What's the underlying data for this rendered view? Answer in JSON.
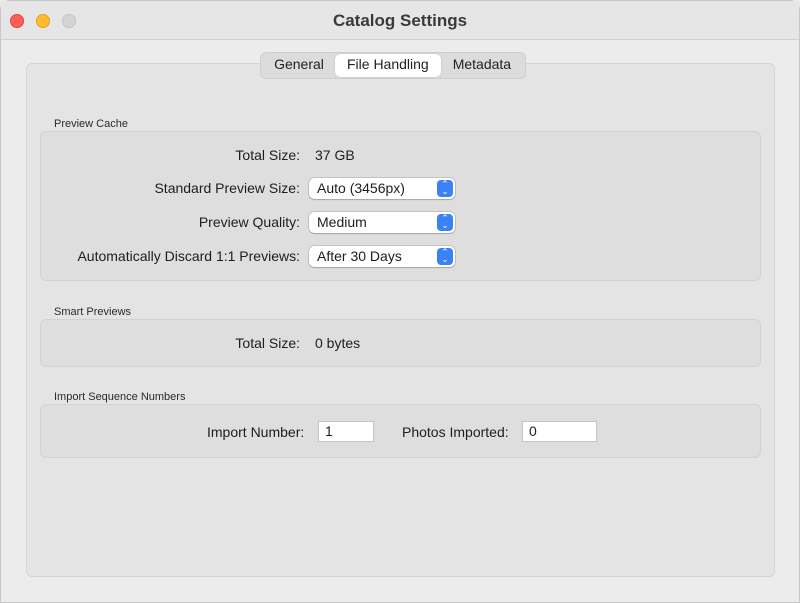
{
  "window": {
    "title": "Catalog Settings"
  },
  "tabs": [
    {
      "label": "General",
      "active": false
    },
    {
      "label": "File Handling",
      "active": true
    },
    {
      "label": "Metadata",
      "active": false
    }
  ],
  "preview_cache": {
    "section_label": "Preview Cache",
    "total_size_label": "Total Size:",
    "total_size_value": "37 GB",
    "standard_preview_size_label": "Standard Preview Size:",
    "standard_preview_size_value": "Auto (3456px)",
    "preview_quality_label": "Preview Quality:",
    "preview_quality_value": "Medium",
    "discard_label": "Automatically Discard 1:1 Previews:",
    "discard_value": "After 30 Days"
  },
  "smart_previews": {
    "section_label": "Smart Previews",
    "total_size_label": "Total Size:",
    "total_size_value": "0 bytes"
  },
  "import_sequence": {
    "section_label": "Import Sequence Numbers",
    "import_number_label": "Import Number:",
    "import_number_value": "1",
    "photos_imported_label": "Photos Imported:",
    "photos_imported_value": "0"
  },
  "colors": {
    "close": "#ff5f57",
    "minimize": "#febc2e",
    "accent": "#3b82f6"
  }
}
